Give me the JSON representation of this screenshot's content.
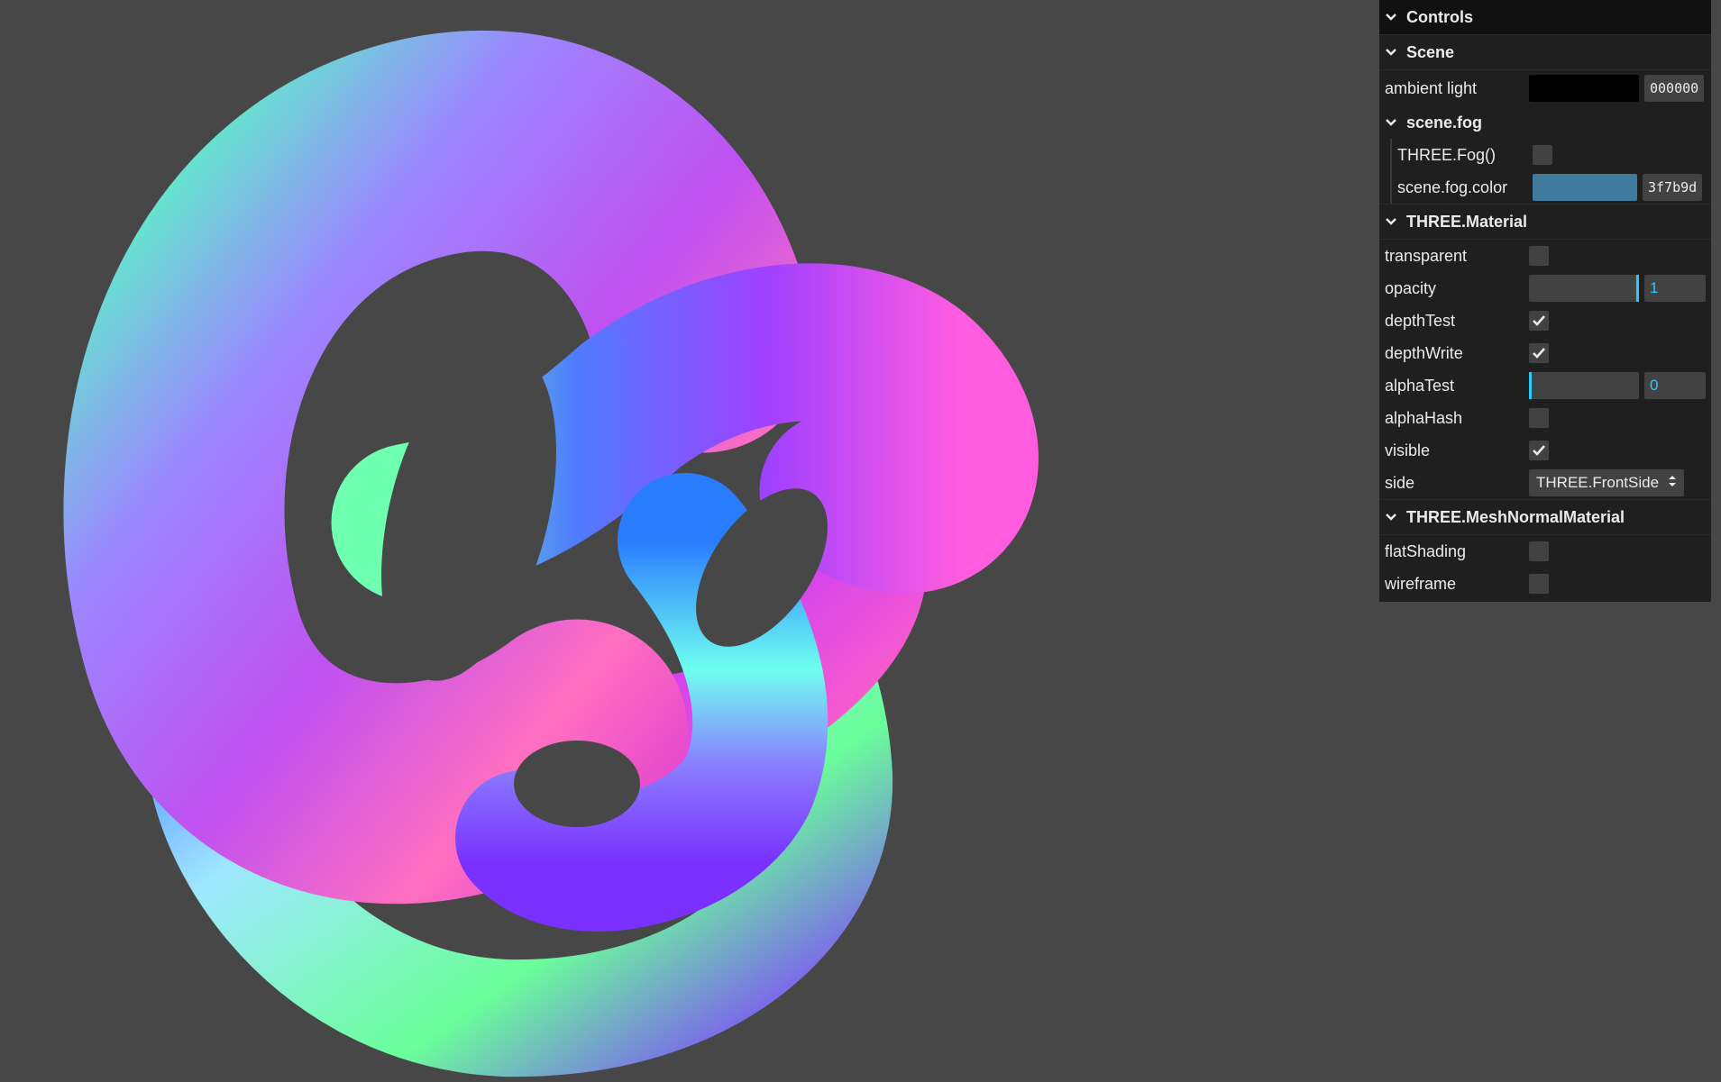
{
  "gui": {
    "root_title": "Controls",
    "scene": {
      "title": "Scene",
      "ambient_light": {
        "label": "ambient light",
        "color": "#000000",
        "hex": "000000"
      },
      "fog": {
        "title": "scene.fog",
        "enabled": {
          "label": "THREE.Fog()",
          "checked": false
        },
        "color": {
          "label": "scene.fog.color",
          "color": "#3f7b9d",
          "hex": "3f7b9d"
        }
      }
    },
    "material": {
      "title": "THREE.Material",
      "transparent": {
        "label": "transparent",
        "checked": false
      },
      "opacity": {
        "label": "opacity",
        "value": "1",
        "fraction": 1
      },
      "depthTest": {
        "label": "depthTest",
        "checked": true
      },
      "depthWrite": {
        "label": "depthWrite",
        "checked": true
      },
      "alphaTest": {
        "label": "alphaTest",
        "value": "0",
        "fraction": 0
      },
      "alphaHash": {
        "label": "alphaHash",
        "checked": false
      },
      "visible": {
        "label": "visible",
        "checked": true
      },
      "side": {
        "label": "side",
        "value": "THREE.FrontSide"
      }
    },
    "normal_material": {
      "title": "THREE.MeshNormalMaterial",
      "flatShading": {
        "label": "flatShading",
        "checked": false
      },
      "wireframe": {
        "label": "wireframe",
        "checked": false
      }
    }
  },
  "colors": {
    "background": "#474747",
    "accent": "#2cc9ff",
    "panel": "#1f1f1f"
  },
  "icons": {
    "folder_toggle": "chevron-down-icon",
    "checkmark": "checkmark-icon",
    "select": "select-arrows-icon"
  }
}
